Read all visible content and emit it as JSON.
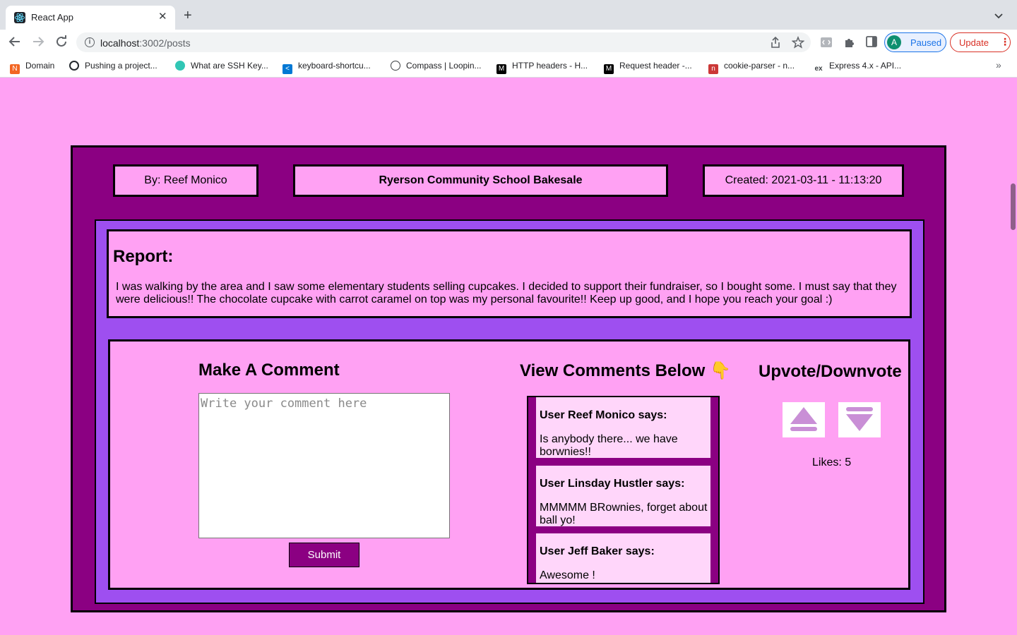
{
  "browser": {
    "tab_title": "React App",
    "url_host": "localhost",
    "url_rest": ":3002/posts",
    "profile_initial": "A",
    "paused_label": "Paused",
    "update_label": "Update",
    "bookmarks": [
      {
        "label": "Domain",
        "icon": "orange-n-icon",
        "color": "#f26522"
      },
      {
        "label": "Pushing a project...",
        "icon": "github-circle-icon",
        "color": "#24292e"
      },
      {
        "label": "What are SSH Key...",
        "icon": "cloud-icon",
        "color": "#31c6b5"
      },
      {
        "label": "keyboard-shortcu...",
        "icon": "vscode-icon",
        "color": "#0078d4"
      },
      {
        "label": "Compass | Loopin...",
        "icon": "compass-icon",
        "color": "#3c4043"
      },
      {
        "label": "HTTP headers - H...",
        "icon": "mdn-icon",
        "color": "#000000"
      },
      {
        "label": "Request header -...",
        "icon": "mdn-icon",
        "color": "#000000"
      },
      {
        "label": "cookie-parser - n...",
        "icon": "npm-icon",
        "color": "#cb3837"
      },
      {
        "label": "Express 4.x - API...",
        "icon": "express-icon",
        "color": "#3c4043"
      }
    ]
  },
  "post": {
    "author": "By: Reef Monico",
    "title": "Ryerson Community School Bakesale",
    "created": "Created: 2021-03-11 - 11:13:20",
    "report_heading": "Report:",
    "report_body": "I was walking by the area and I saw some elementary students selling cupcakes. I decided to support their fundraiser, so I bought some. I must say that they were delicious!! The chocolate cupcake with carrot caramel on top was my personal favourite!! Keep up good, and I hope you reach your goal :)"
  },
  "comment_form": {
    "title": "Make A Comment",
    "placeholder": "Write your comment here",
    "submit_label": "Submit"
  },
  "comments": {
    "title": "View Comments Below",
    "title_emoji": "👇",
    "items": [
      {
        "user": "User Reef Monico says:",
        "text": "Is anybody there... we have borwnies!!"
      },
      {
        "user": "User Linsday Hustler says:",
        "text": "MMMMM BRownies, forget about ball yo!"
      },
      {
        "user": "User Jeff Baker says:",
        "text": "Awesome !"
      }
    ]
  },
  "votes": {
    "title": "Upvote/Downvote",
    "likes": "Likes: 5"
  },
  "colors": {
    "page_bg": "#ffa1f3",
    "post_bg": "#8b0082",
    "inner_bg": "#9e4ff0",
    "comment_card_bg": "#ffd6fa",
    "vote_icon": "#c98fd6"
  }
}
